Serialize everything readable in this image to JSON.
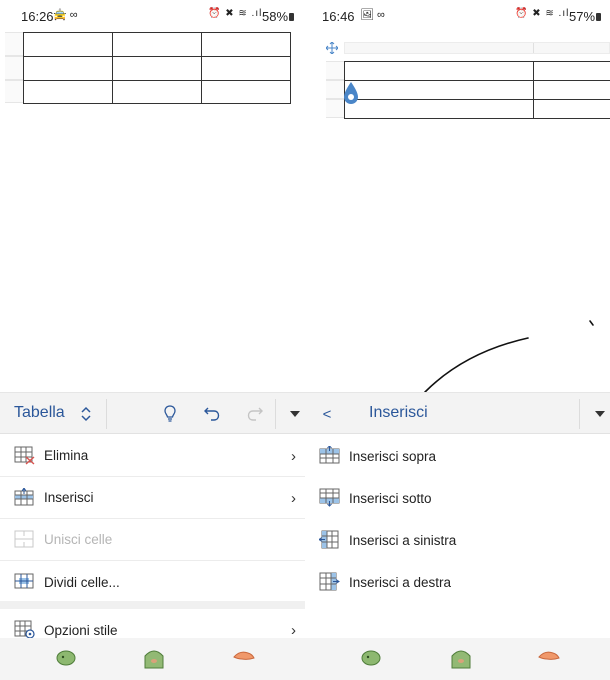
{
  "left": {
    "status": {
      "time": "16:26",
      "battery": "58%"
    },
    "toolbar": {
      "title": "Tabella",
      "title_chevron": "⌃⌄"
    },
    "menu": [
      {
        "label": "Elimina",
        "has_submenu": true,
        "enabled": true,
        "icon": "table-delete-icon"
      },
      {
        "label": "Inserisci",
        "has_submenu": true,
        "enabled": true,
        "icon": "table-insert-icon"
      },
      {
        "label": "Unisci celle",
        "has_submenu": false,
        "enabled": false,
        "icon": "merge-cells-icon"
      },
      {
        "label": "Dividi celle...",
        "has_submenu": false,
        "enabled": true,
        "icon": "split-cells-icon"
      },
      {
        "label": "Opzioni stile",
        "has_submenu": true,
        "enabled": true,
        "icon": "style-options-icon"
      }
    ]
  },
  "right": {
    "status": {
      "time": "16:46",
      "battery": "57%"
    },
    "toolbar": {
      "back": "<",
      "title": "Inserisci"
    },
    "menu": [
      {
        "label": "Inserisci sopra",
        "icon": "insert-above-icon"
      },
      {
        "label": "Inserisci sotto",
        "icon": "insert-below-icon"
      },
      {
        "label": "Inserisci a sinistra",
        "icon": "insert-left-icon"
      },
      {
        "label": "Inserisci a destra",
        "icon": "insert-right-icon"
      }
    ]
  },
  "colors": {
    "accent": "#2b579a",
    "toolbar_bg": "#f3f3f3",
    "icon_blue": "#4a86c8",
    "icon_red": "#d9534f",
    "disabled": "#b5b5b5"
  }
}
